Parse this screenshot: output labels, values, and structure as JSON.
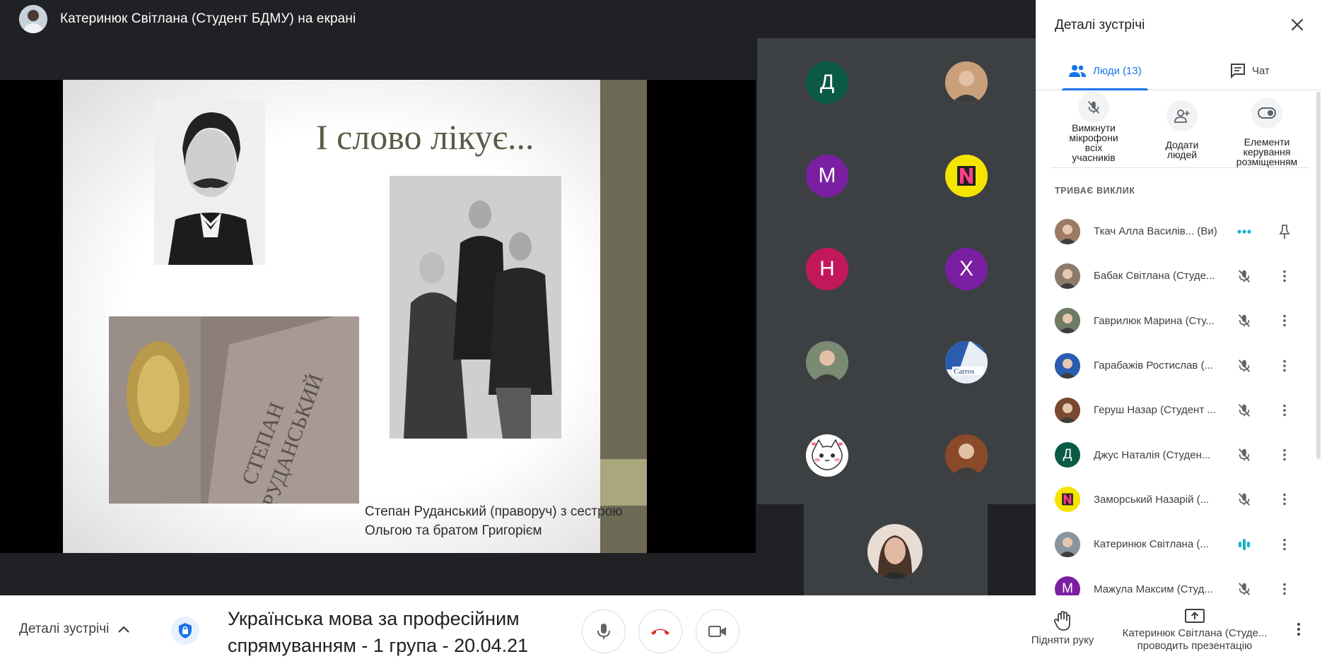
{
  "presenter": {
    "title": "Катеринюк Світлана (Студент БДМУ) на екрані"
  },
  "slide": {
    "title": "І слово лікує...",
    "caption_line1": "Степан Руданський (праворуч) з сестрою",
    "caption_line2": "Ольгою та братом Григорієм",
    "colors": {
      "strip_dark": "#6d6a55",
      "strip_light": "#a9a77d",
      "title": "#5c5a48"
    }
  },
  "thumbnails": [
    {
      "initial": "Д",
      "color": "#0b5a45"
    },
    {
      "initial": "",
      "color": "#c9a07a",
      "icon": "avatar-photo"
    },
    {
      "initial": "М",
      "color": "#7b1fa2"
    },
    {
      "initial": "",
      "color": "#f5e400",
      "icon": "logo-n"
    },
    {
      "initial": "Н",
      "color": "#c2185b"
    },
    {
      "initial": "Х",
      "color": "#7b1fa2"
    },
    {
      "initial": "",
      "color": "#7a8a73",
      "icon": "avatar-photo"
    },
    {
      "initial": "",
      "color": "#2a5db0",
      "icon": "logo-carros"
    },
    {
      "initial": "",
      "color": "#ffffff",
      "icon": "cat-avatar"
    },
    {
      "initial": "",
      "color": "#8a4a2a",
      "icon": "avatar-photo"
    }
  ],
  "panel": {
    "title": "Деталі зустрічі",
    "tab_people": "Люди (13)",
    "tab_chat": "Чат",
    "act_mute_l1": "Вимкнути",
    "act_mute_l2": "мікрофони",
    "act_mute_l3": "всіх",
    "act_mute_l4": "учасників",
    "act_add_l1": "Додати",
    "act_add_l2": "людей",
    "act_host_l1": "Елементи",
    "act_host_l2": "керування",
    "act_host_l3": "розміщенням",
    "section": "ТРИВАЄ ВИКЛИК",
    "people": [
      {
        "name": "Ткач Алла Василів...  (Ви)",
        "avatar_color": "#9c7a66",
        "initial": "",
        "status": "speaking",
        "action": "pin"
      },
      {
        "name": "Бабак Світлана (Студе...",
        "avatar_color": "#8c7b6a",
        "initial": "",
        "status": "muted",
        "action": "more"
      },
      {
        "name": "Гаврилюк Марина (Сту...",
        "avatar_color": "#6e7a64",
        "initial": "",
        "status": "muted",
        "action": "more"
      },
      {
        "name": "Гарабажів Ростислав (...",
        "avatar_color": "#2a5db0",
        "initial": "",
        "status": "muted",
        "action": "more"
      },
      {
        "name": "Геруш Назар (Студент ...",
        "avatar_color": "#7a4a30",
        "initial": "",
        "status": "muted",
        "action": "more"
      },
      {
        "name": "Джус Наталія (Студен...",
        "avatar_color": "#0b5a45",
        "initial": "Д",
        "status": "muted",
        "action": "more"
      },
      {
        "name": "Заморський Назарій (...",
        "avatar_color": "#f5e400",
        "initial": "",
        "status": "muted",
        "action": "more"
      },
      {
        "name": "Катеринюк Світлана (...",
        "avatar_color": "#8795a0",
        "initial": "",
        "status": "audio",
        "action": "more"
      },
      {
        "name": "Мажула Максим (Студ...",
        "avatar_color": "#7b1fa2",
        "initial": "М",
        "status": "muted",
        "action": "more"
      }
    ]
  },
  "bottom": {
    "details_label": "Деталі зустрічі",
    "meeting_title_l1": "Українська мова за професійним",
    "meeting_title_l2": "спрямуванням - 1 група - 20.04.21",
    "raise_hand": "Підняти руку",
    "present_l1": "Катеринюк Світлана (Студе...",
    "present_l2": "проводить презентацію",
    "colors": {
      "hangup": "#d93025",
      "accent": "#1a73e8"
    }
  }
}
